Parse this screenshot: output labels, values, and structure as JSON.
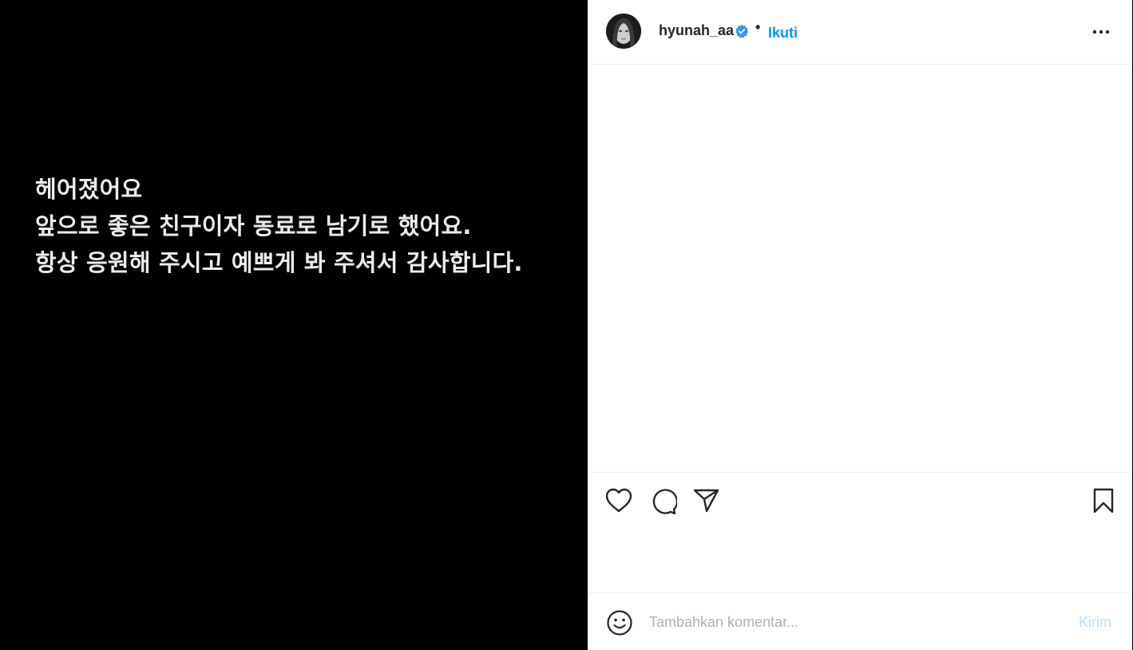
{
  "post": {
    "text_lines": [
      "헤어졌어요",
      "앞으로 좋은 친구이자 동료로 남기로 했어요.",
      "항상 응원해 주시고 예쁘게 봐 주셔서 감사합니다."
    ]
  },
  "header": {
    "username": "hyunah_aa",
    "verified_icon": "verified-badge-icon",
    "separator": "•",
    "follow_label": "Ikuti",
    "more_icon": "more-options-icon"
  },
  "actions": {
    "like_icon": "heart-icon",
    "comment_icon": "comment-icon",
    "share_icon": "send-icon",
    "save_icon": "bookmark-icon"
  },
  "comment": {
    "emoji_icon": "emoji-icon",
    "placeholder": "Tambahkan komentar...",
    "send_label": "Kirim"
  },
  "colors": {
    "accent": "#0095f6",
    "send_disabled": "#b2dffc",
    "media_bg": "#000000",
    "panel_bg": "#ffffff"
  }
}
